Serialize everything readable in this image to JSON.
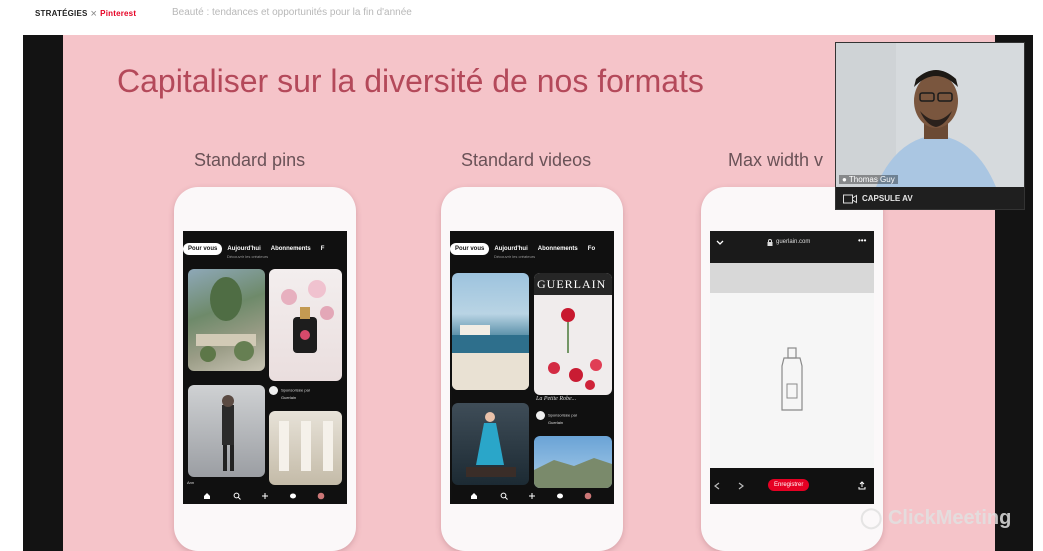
{
  "header": {
    "brand_strategies": "STRATÉGIES",
    "brand_separator": "×",
    "brand_pinterest": "Pinterest",
    "subtitle": "Beauté : tendances et opportunités pour la fin d'année"
  },
  "slide": {
    "title": "Capitaliser sur la diversité de nos formats",
    "columns": [
      "Standard pins",
      "Standard videos",
      "Max width v"
    ]
  },
  "phone1": {
    "tabs": [
      "Pour vous",
      "Aujourd'hui",
      "Abonnements",
      "F"
    ],
    "subtext": "Découvrir les créateurs",
    "promo_line1": "Sponsorisée par",
    "promo_line2": "Guerlain",
    "footer": "Ann"
  },
  "phone2": {
    "tabs": [
      "Pour vous",
      "Aujourd'hui",
      "Abonnements",
      "Fo"
    ],
    "subtext": "Découvrir les créateurs",
    "brand_word": "GUERLAIN",
    "script_text": "La Petite Robe...",
    "promo_line1": "Sponsorisée par",
    "promo_line2": "Guerlain"
  },
  "phone3": {
    "url": "guerlain.com",
    "menu": "•••",
    "save_button": "Enregistrer"
  },
  "webcam": {
    "name": "Thomas Guy",
    "label": "CAPSULE AV"
  },
  "watermark": "ClickMeeting",
  "colors": {
    "slide_bg": "#f5c4c9",
    "title": "#b4495a",
    "pinterest_red": "#e60023"
  }
}
